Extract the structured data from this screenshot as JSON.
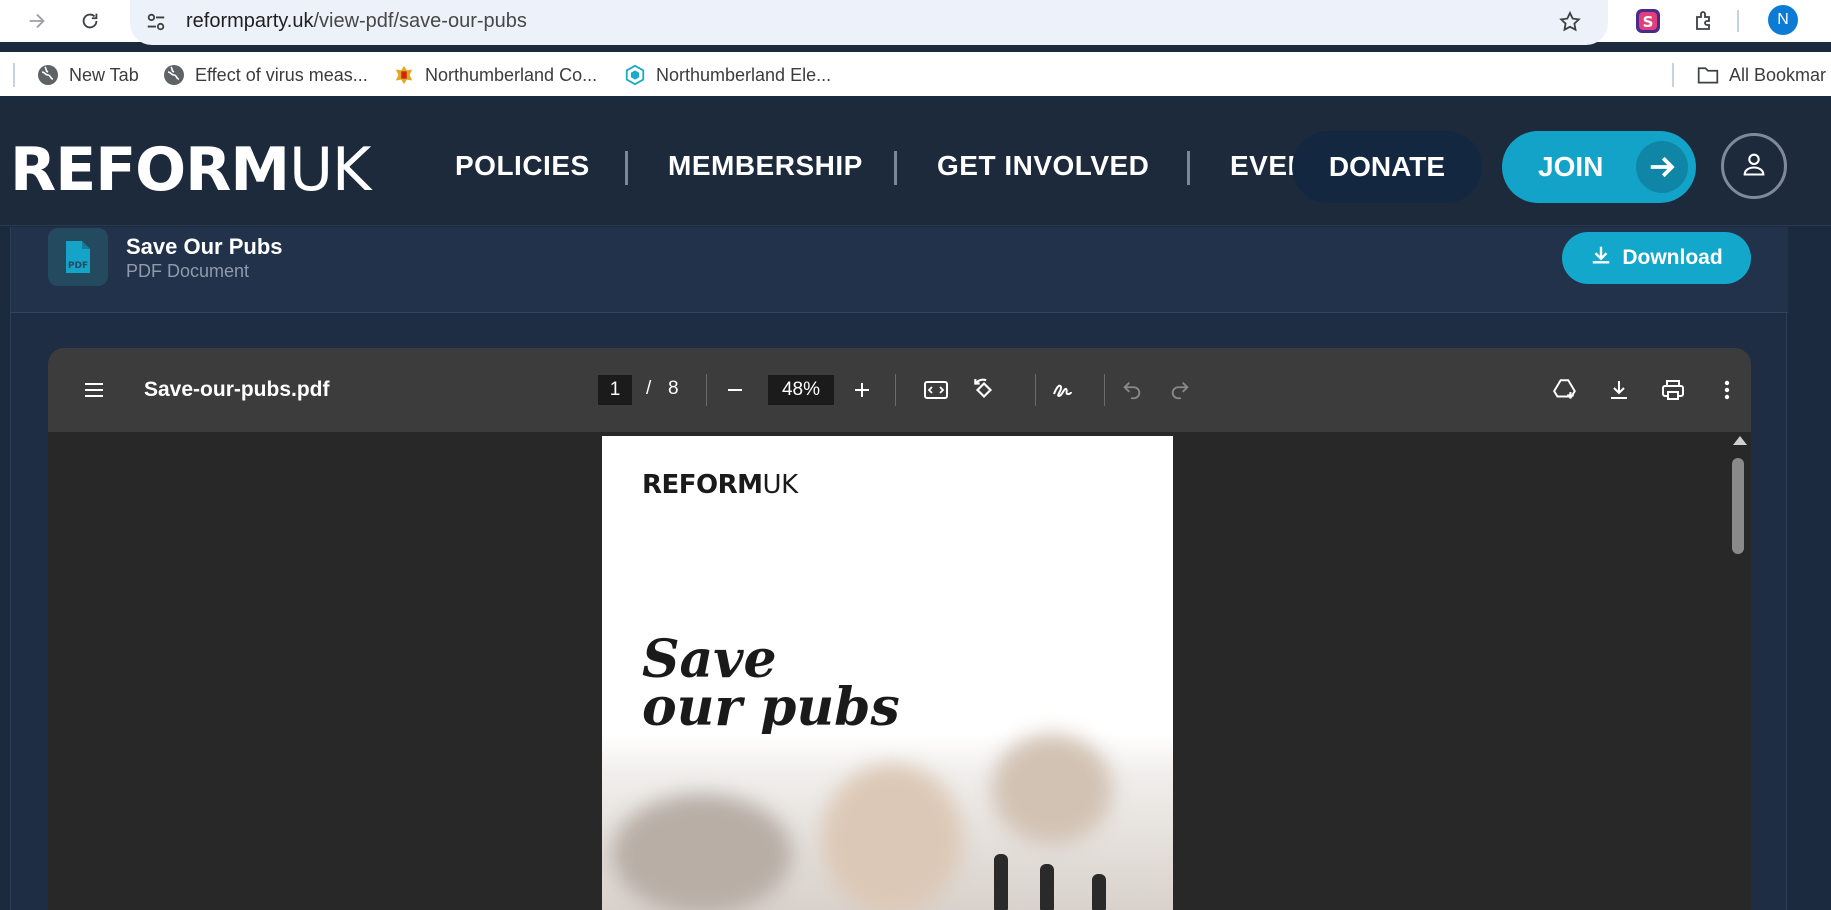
{
  "browser": {
    "url_host": "reformparty.uk",
    "url_path": "/view-pdf/save-our-pubs",
    "profile_initial": "N",
    "bookmarks": [
      {
        "label": "New Tab"
      },
      {
        "label": "Effect of virus meas..."
      },
      {
        "label": "Northumberland Co..."
      },
      {
        "label": "Northumberland Ele..."
      }
    ],
    "all_bookmarks": "All Bookmar"
  },
  "site": {
    "logo_bold": "REFORM",
    "logo_light": "UK",
    "nav": [
      "POLICIES",
      "MEMBERSHIP",
      "GET INVOLVED",
      "EVEI"
    ],
    "donate_label": "DONATE",
    "join_label": "JOIN"
  },
  "document": {
    "title": "Save Our Pubs",
    "subtitle": "PDF Document",
    "icon_text": "PDF",
    "download_label": "Download"
  },
  "viewer": {
    "filename": "Save-our-pubs.pdf",
    "current_page": "1",
    "page_separator": "/",
    "total_pages": "8",
    "zoom": "48%"
  },
  "pdf_page": {
    "logo_bold": "REFORM",
    "logo_light": "UK",
    "title_line1": "Save",
    "title_line2": "our pubs"
  },
  "colors": {
    "header_bg": "#1c2a3b",
    "accent": "#14a7cc",
    "donate_bg": "#142740"
  }
}
